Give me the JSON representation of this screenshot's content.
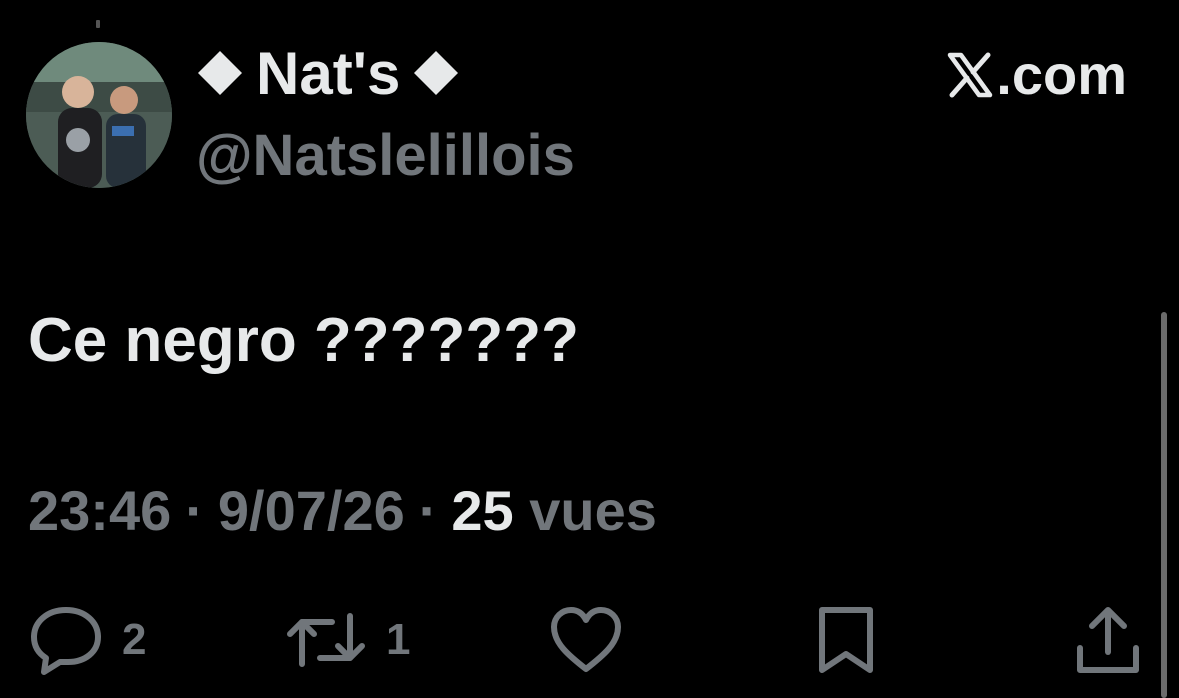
{
  "author": {
    "display_name": "Nat's",
    "handle": "@Natslelillois"
  },
  "brand": {
    "label": ".com",
    "icon": "x-logo-icon"
  },
  "tweet": {
    "text": "Ce negro ???????",
    "time": "23:46",
    "separator": "·",
    "date": "9/07/26",
    "views_count": "25",
    "views_label": "vues"
  },
  "actions": {
    "replies": "2",
    "reposts": "1"
  },
  "colors": {
    "background": "#000000",
    "primary_text": "#e7e9ea",
    "secondary_text": "#71767b"
  }
}
